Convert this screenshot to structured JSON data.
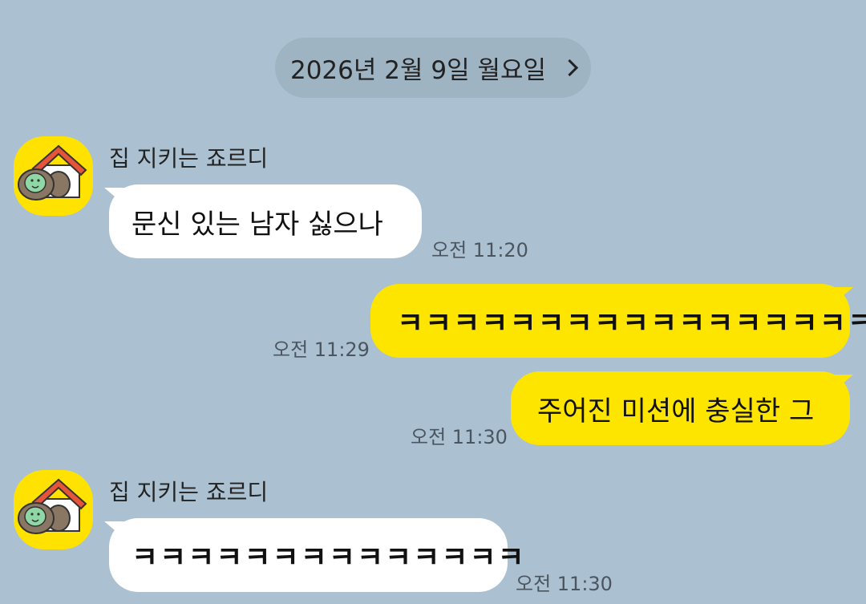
{
  "date_header": {
    "label": "2026년 2월 9일 월요일"
  },
  "messages": [
    {
      "direction": "incoming",
      "sender": "집 지키는 죠르디",
      "text": "문신 있는 남자 싫으나",
      "time": "오전 11:20"
    },
    {
      "direction": "outgoing",
      "text": "ㅋㅋㅋㅋㅋㅋㅋㅋㅋㅋㅋㅋㅋㅋㅋㅋㅋ",
      "time": "오전 11:29"
    },
    {
      "direction": "outgoing",
      "text": "주어진 미션에 충실한 그",
      "time": "오전 11:30"
    },
    {
      "direction": "incoming",
      "sender": "집 지키는 죠르디",
      "text": "ㅋㅋㅋㅋㅋㅋㅋㅋㅋㅋㅋㅋㅋㅋ",
      "time": "오전 11:30"
    }
  ],
  "colors": {
    "background": "#abc1d1",
    "incoming_bubble": "#ffffff",
    "outgoing_bubble": "#fee500",
    "avatar_bg": "#ffe200"
  }
}
